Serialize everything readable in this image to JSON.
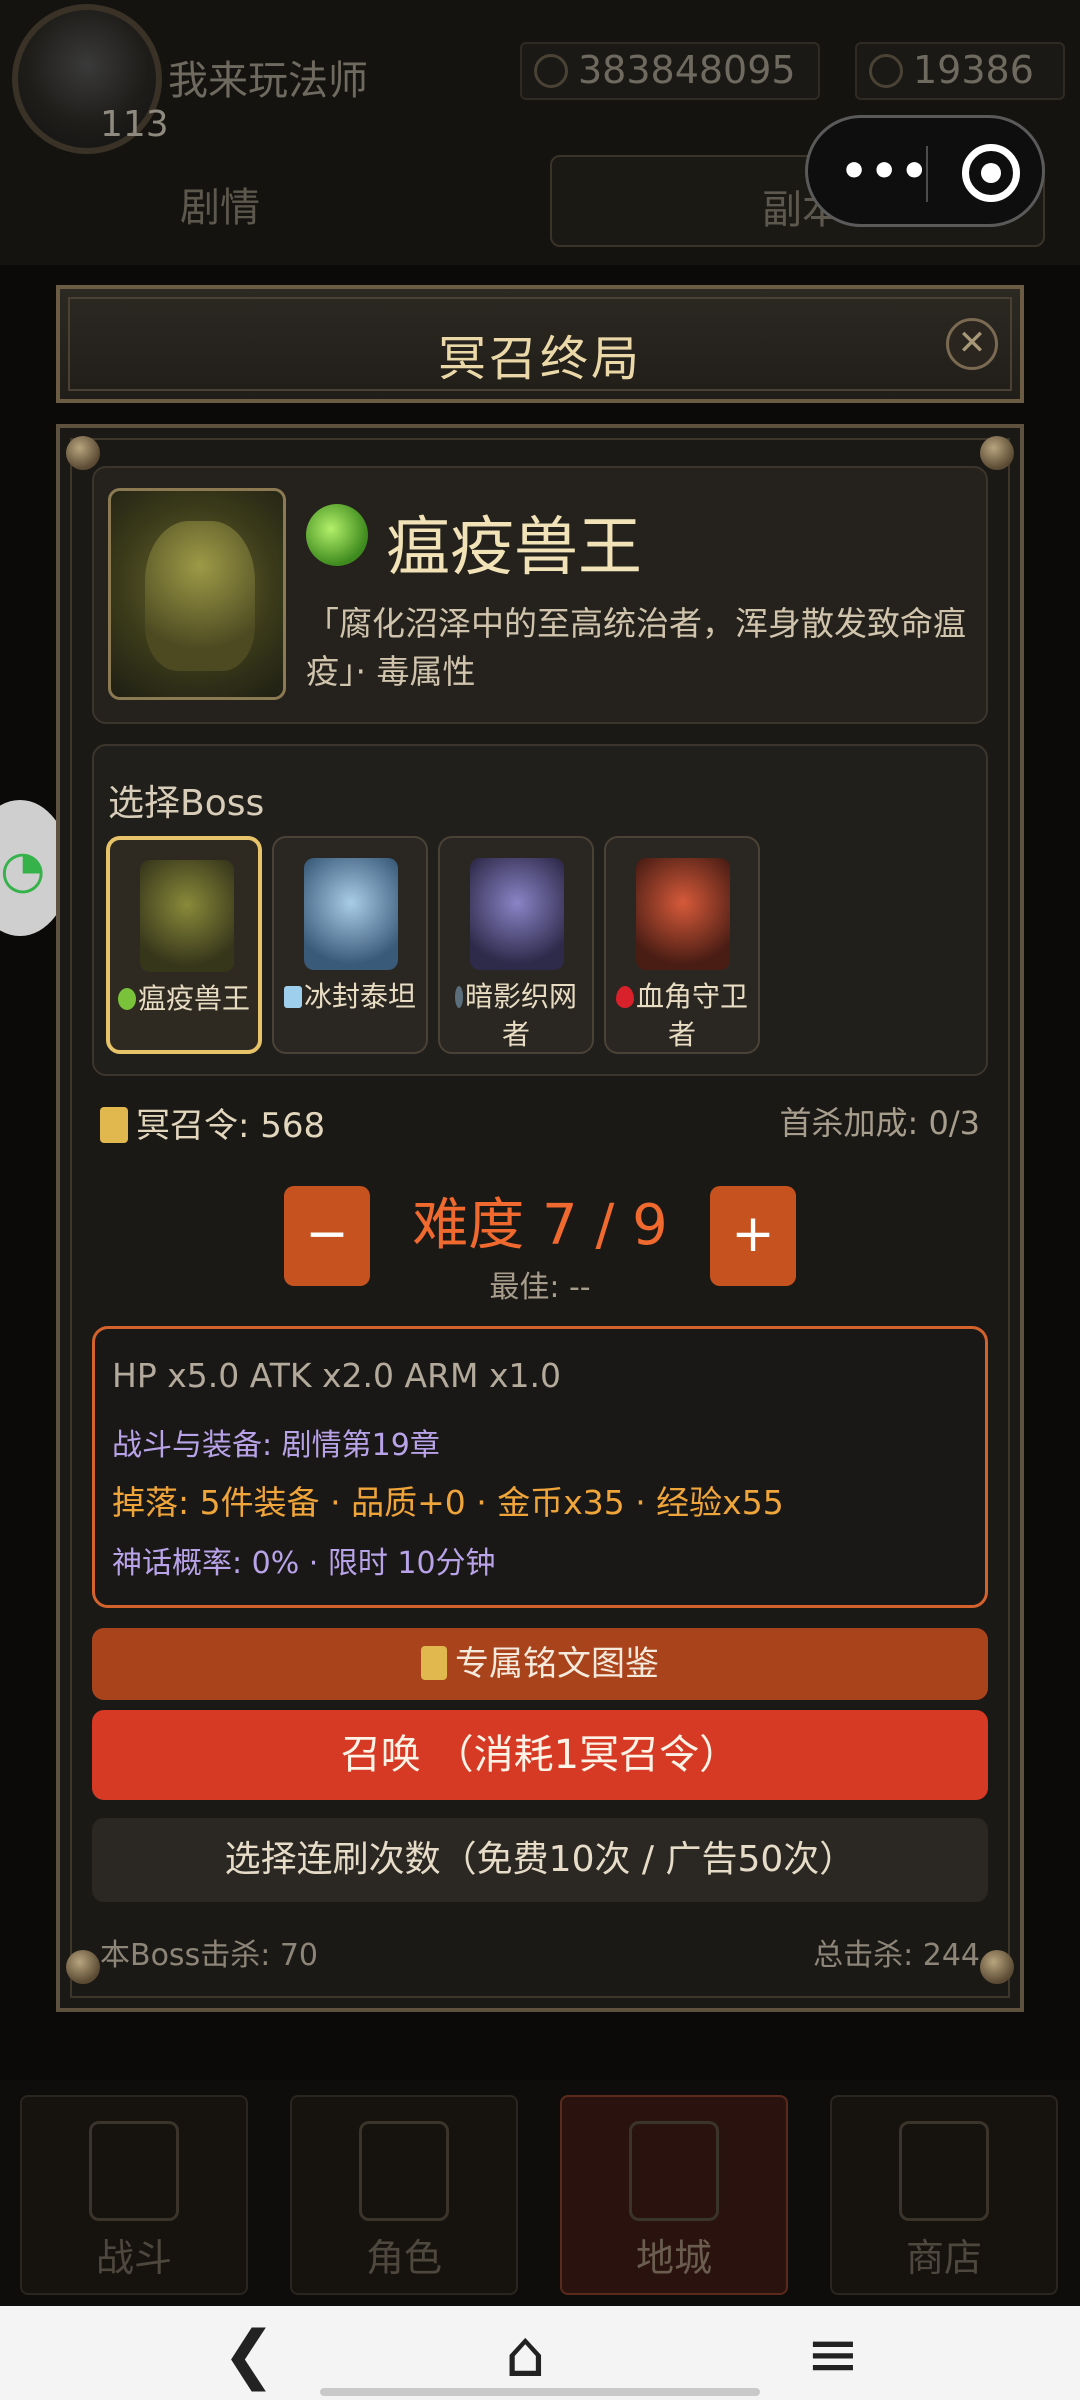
{
  "player": {
    "name": "我来玩法师",
    "level": "113"
  },
  "currency": {
    "gold": "383848095",
    "gems": "19386"
  },
  "top_tabs": {
    "story": "剧情",
    "dungeon": "副本"
  },
  "modal": {
    "title": "冥召终局",
    "close_glyph": "✕",
    "boss": {
      "name": "瘟疫兽王",
      "description": "「腐化沼泽中的至高统治者，浑身散发致命瘟疫」· 毒属性"
    },
    "select": {
      "title": "选择Boss",
      "options": [
        {
          "label": "瘟疫兽王",
          "icon": "poison-icon",
          "selected": true
        },
        {
          "label": "冰封泰坦",
          "icon": "ice-icon",
          "selected": false
        },
        {
          "label": "暗影织网者",
          "icon": "shadow-icon",
          "selected": false
        },
        {
          "label": "血角守卫者",
          "icon": "blood-icon",
          "selected": false
        }
      ]
    },
    "token": "冥召令: 568",
    "first_kill": "首杀加成: 0/3",
    "difficulty": {
      "minus": "−",
      "plus": "+",
      "label": "难度 7 / 9",
      "best": "最佳: --"
    },
    "info": {
      "line1": "HP x5.0  ATK x2.0  ARM x1.0",
      "line2": "战斗与装备: 剧情第19章",
      "line3": "掉落: 5件装备 · 品质+0 · 金币x35 · 经验x55",
      "line4": "神话概率: 0%  · 限时 10分钟"
    },
    "buttons": {
      "codex": "专属铭文图鉴",
      "summon": "召唤 （消耗1冥召令）",
      "multi": "选择连刷次数（免费10次 / 广告50次）"
    },
    "boss_kills": "本Boss击杀: 70",
    "total_kills": "总击杀: 244"
  },
  "bottom_nav": [
    {
      "label": "战斗"
    },
    {
      "label": "角色"
    },
    {
      "label": "地城",
      "active": true
    },
    {
      "label": "商店"
    }
  ],
  "colors": {
    "accent": "#d63a25",
    "difficulty": "#f0692e",
    "selected_border": "#e7c46a",
    "info_purple": "#b8a2e8",
    "info_orange": "#f0a53a"
  }
}
